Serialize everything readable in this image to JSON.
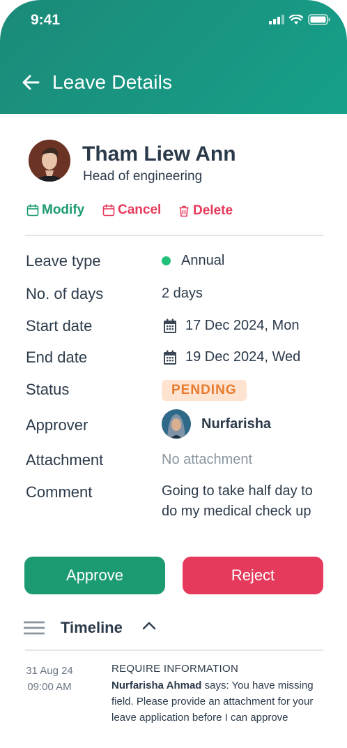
{
  "status_bar": {
    "time": "9:41"
  },
  "header": {
    "title": "Leave Details"
  },
  "employee": {
    "name": "Tham Liew Ann",
    "title": "Head of engineering"
  },
  "actions": {
    "modify": "Modify",
    "cancel": "Cancel",
    "delete": "Delete"
  },
  "details": {
    "leave_type": {
      "label": "Leave type",
      "value": "Annual"
    },
    "days": {
      "label": "No. of days",
      "value": "2 days"
    },
    "start": {
      "label": "Start date",
      "value": "17 Dec 2024, Mon"
    },
    "end": {
      "label": "End date",
      "value": "19 Dec 2024, Wed"
    },
    "status": {
      "label": "Status",
      "value": "PENDING"
    },
    "approver": {
      "label": "Approver",
      "value": "Nurfarisha"
    },
    "attachment": {
      "label": "Attachment",
      "value": "No attachment"
    },
    "comment": {
      "label": "Comment",
      "value": "Going to take half day to do my medical check up"
    }
  },
  "buttons": {
    "approve": "Approve",
    "reject": "Reject"
  },
  "timeline": {
    "title": "Timeline",
    "entries": [
      {
        "date": "31 Aug 24",
        "time": "09:00 AM",
        "heading": "REQUIRE INFORMATION",
        "author": "Nurfarisha Ahmad",
        "message": " says: You have missing field. Please provide an attachment for your leave application before I can approve"
      }
    ]
  },
  "colors": {
    "primary": "#1c9a72",
    "danger": "#e63a5c",
    "pending_bg": "#fde3d0",
    "pending_text": "#e87a2d",
    "header": "#1b8a78"
  }
}
